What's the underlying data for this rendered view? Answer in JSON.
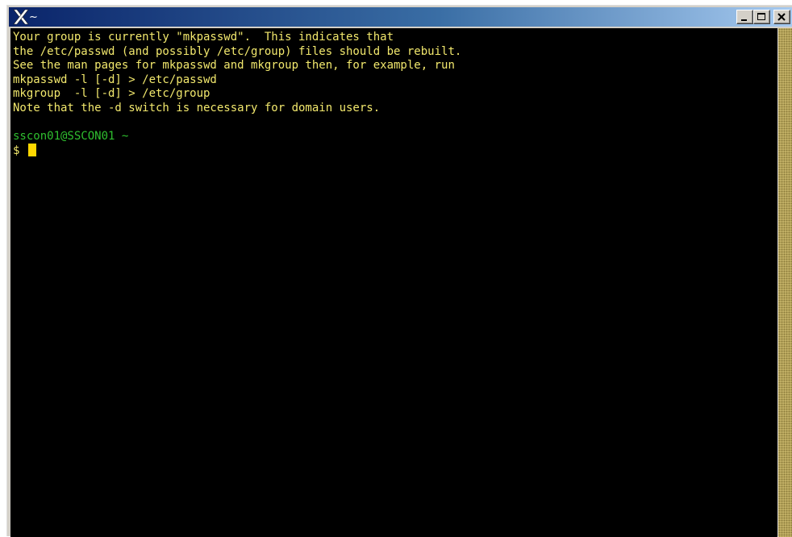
{
  "window": {
    "title": "~",
    "controls": {
      "minimize_icon": "minimize-icon",
      "maximize_icon": "maximize-icon",
      "close_icon": "close-icon"
    }
  },
  "terminal": {
    "colors": {
      "background": "#000000",
      "text": "#f2e86d",
      "prompt": "#2fbf2f",
      "cursor": "#ffd700"
    },
    "lines": [
      {
        "text": "Your group is currently \"mkpasswd\".  This indicates that",
        "color": "#f2e86d"
      },
      {
        "text": "the /etc/passwd (and possibly /etc/group) files should be rebuilt.",
        "color": "#f2e86d"
      },
      {
        "text": "See the man pages for mkpasswd and mkgroup then, for example, run",
        "color": "#f2e86d"
      },
      {
        "text": "mkpasswd -l [-d] > /etc/passwd",
        "color": "#f2e86d"
      },
      {
        "text": "mkgroup  -l [-d] > /etc/group",
        "color": "#f2e86d"
      },
      {
        "text": "Note that the -d switch is necessary for domain users.",
        "color": "#f2e86d"
      },
      {
        "text": "",
        "color": "#f2e86d"
      },
      {
        "text": "sscon01@SSCON01 ~",
        "color": "#2fbf2f"
      }
    ],
    "prompt": "$ "
  }
}
